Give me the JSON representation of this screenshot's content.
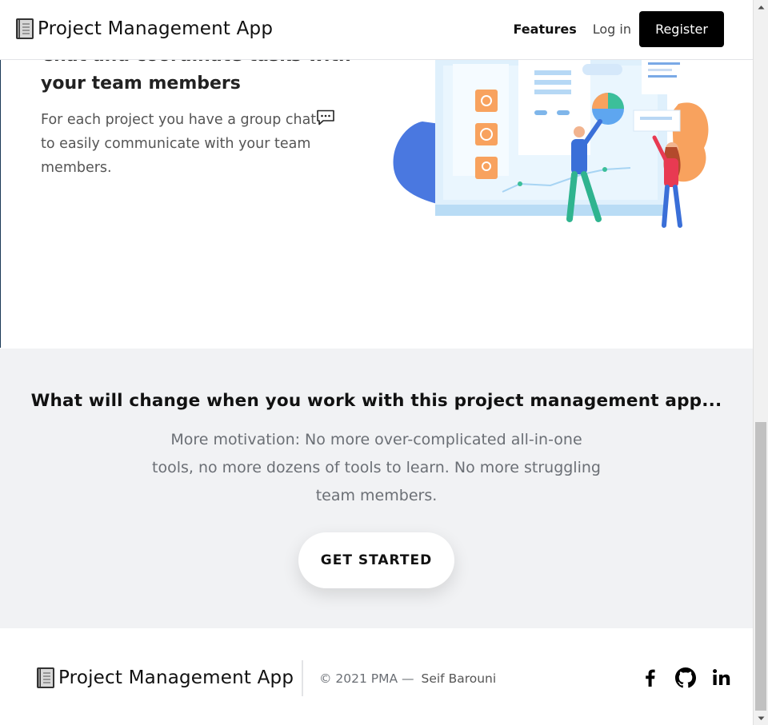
{
  "header": {
    "brand": "Project Management App",
    "nav": {
      "features": "Features",
      "login": "Log in",
      "register": "Register"
    }
  },
  "feature": {
    "title": "Chat and coordinate tasks with your team members",
    "desc_before": "For each project you have a group chat",
    "desc_after": " to easily communicate with your team members."
  },
  "cta": {
    "heading": "What will change when you work with this project management app...",
    "text": "More motivation: No more over-complicated all-in-one tools, no more dozens of tools to learn. No more struggling team members.",
    "button": "GET STARTED"
  },
  "footer": {
    "brand": "Project Management App",
    "copyright": "© 2021 PMA —",
    "author": "Seif Barouni"
  },
  "icons": {
    "brand": "notebook-icon",
    "chat": "speech-bubble-icon",
    "social": [
      "facebook-icon",
      "github-icon",
      "linkedin-icon"
    ]
  },
  "colors": {
    "register_bg": "#000000",
    "cta_bg": "#f1f2f4",
    "illustration_blue": "#4a78e0",
    "illustration_orange": "#f8a25e",
    "illustration_teal": "#3cbf9a"
  }
}
